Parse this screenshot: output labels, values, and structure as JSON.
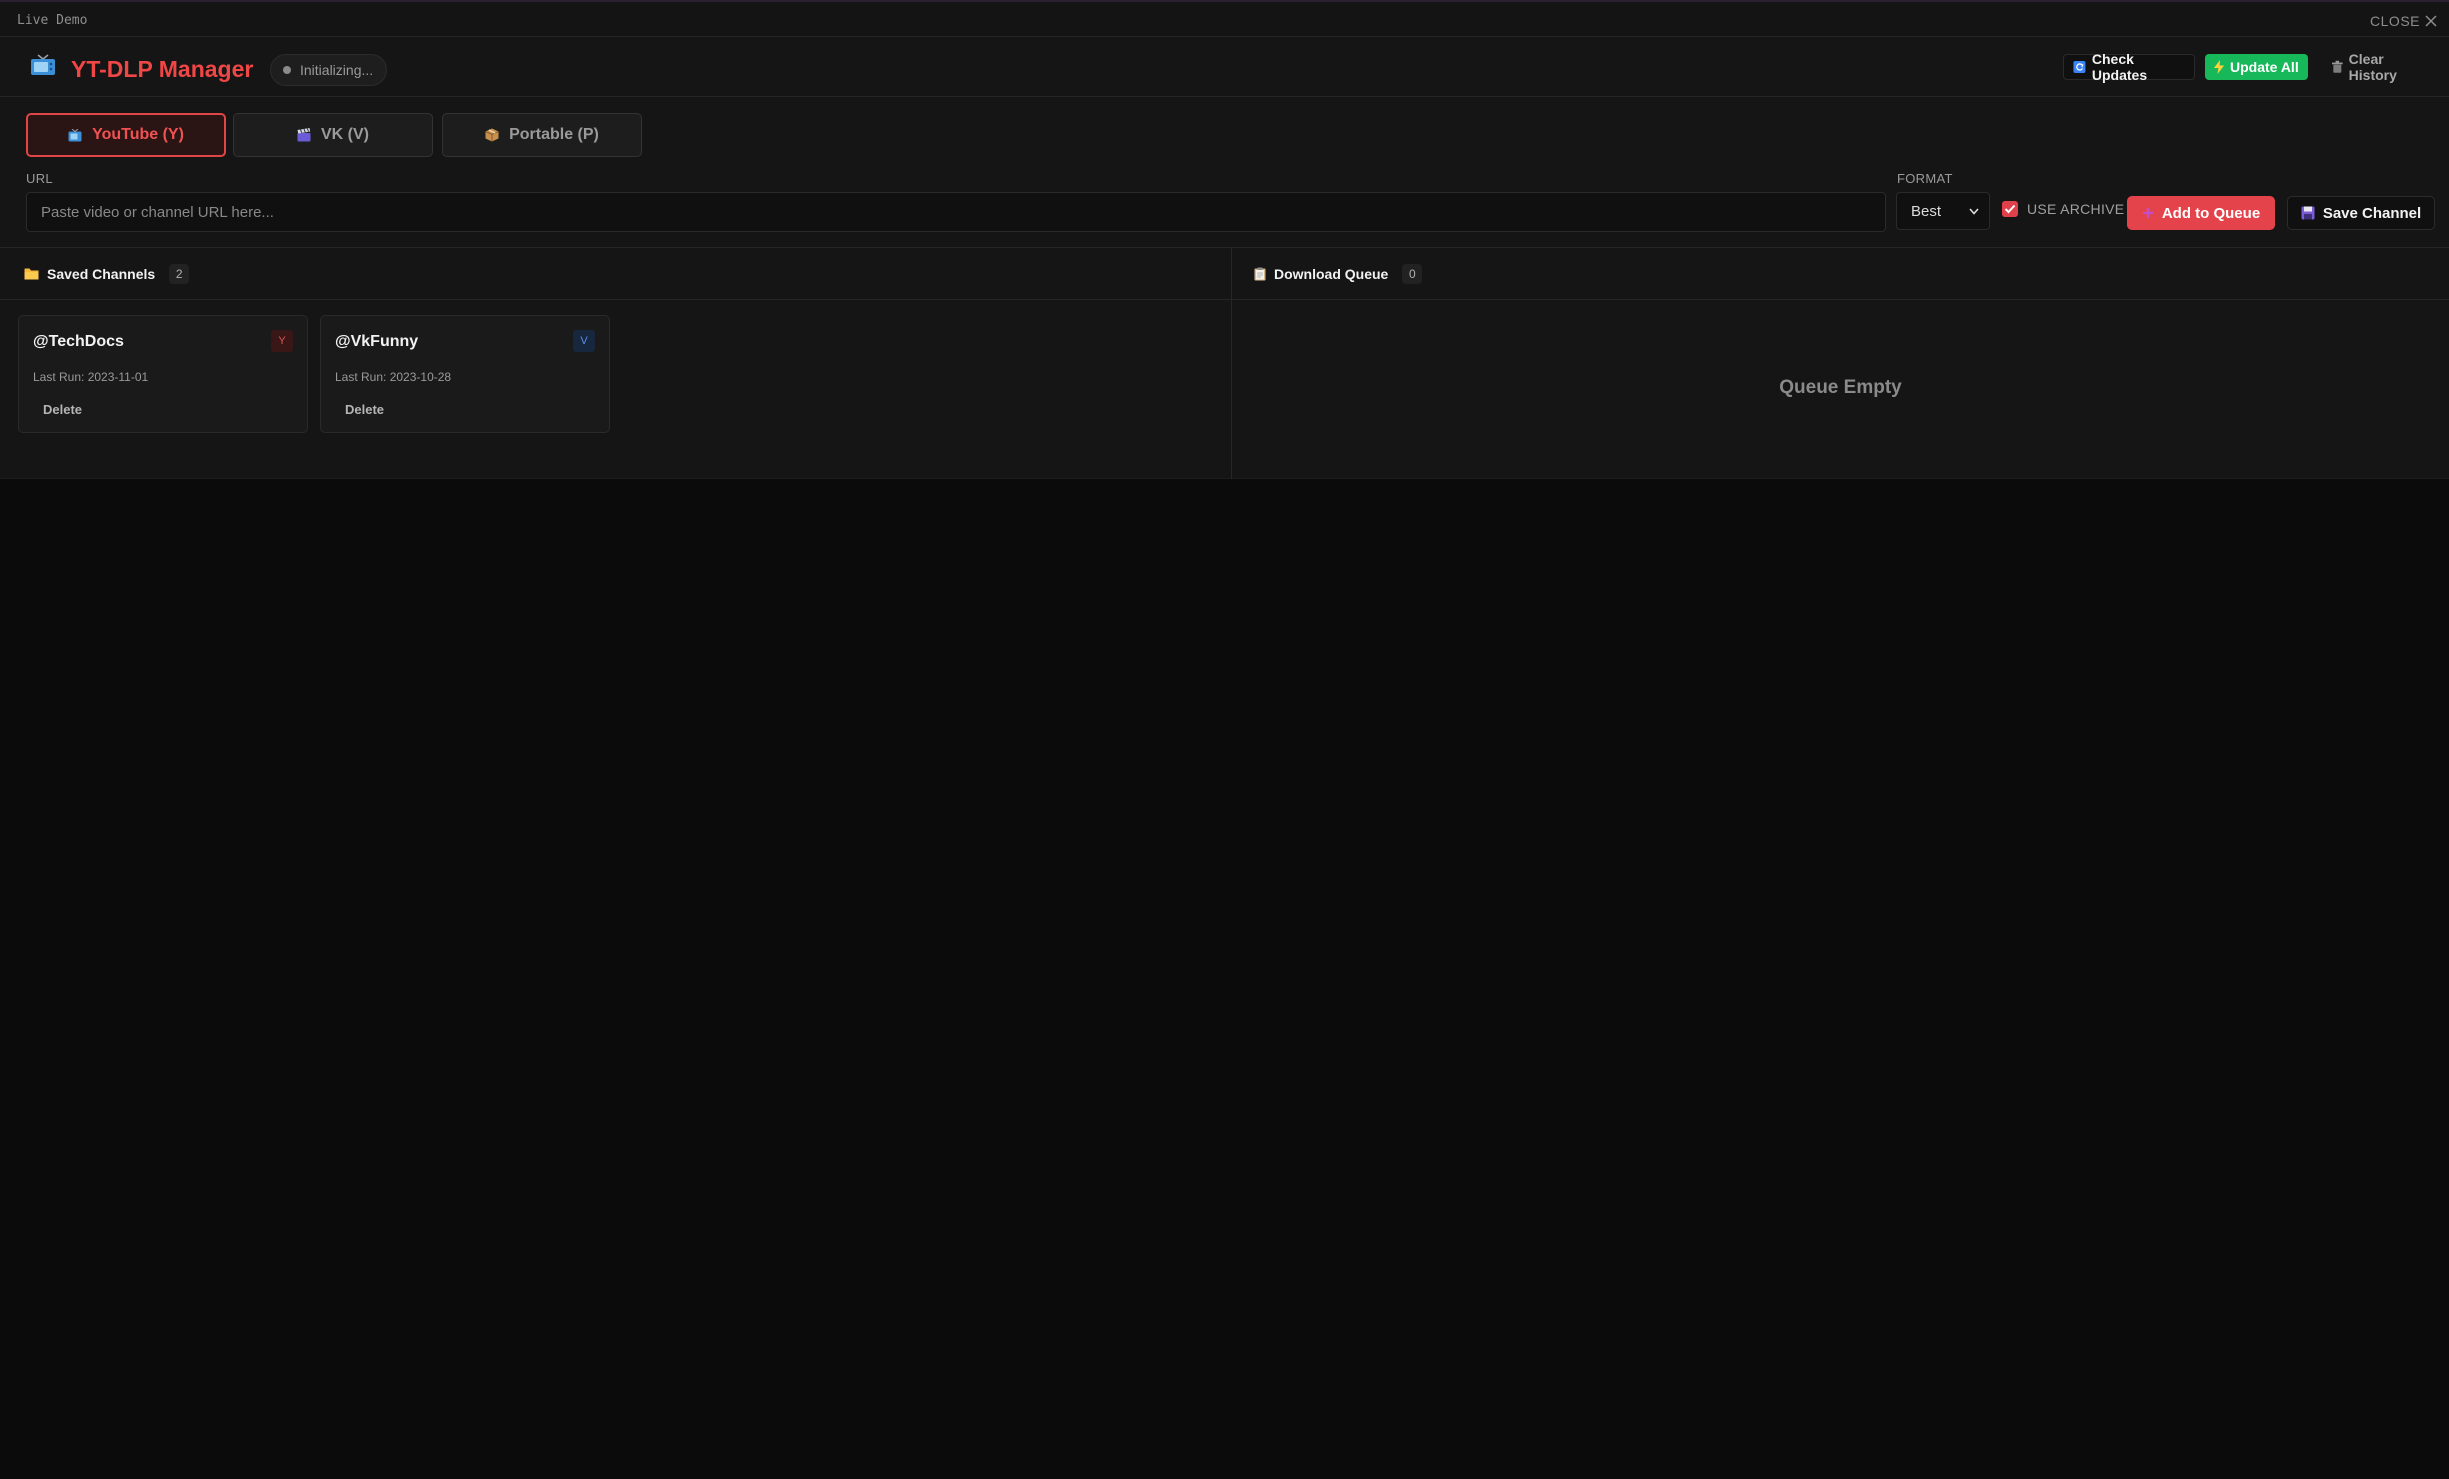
{
  "topbar": {
    "demo_label": "Live Demo",
    "close_label": "CLOSE"
  },
  "header": {
    "title": "YT-DLP Manager",
    "status": "Initializing...",
    "check_updates": "Check Updates",
    "update_all": "Update All",
    "clear_history": "Clear History"
  },
  "tabs": [
    {
      "label": "YouTube (Y)",
      "active": true
    },
    {
      "label": "VK (V)",
      "active": false
    },
    {
      "label": "Portable (P)",
      "active": false
    }
  ],
  "form": {
    "url_label": "URL",
    "url_placeholder": "Paste video or channel URL here...",
    "url_value": "",
    "format_label": "FORMAT",
    "format_value": "Best",
    "use_archive_label": "USE ARCHIVE",
    "use_archive_checked": true,
    "add_to_queue": "Add to Queue",
    "save_channel": "Save Channel"
  },
  "saved_channels": {
    "title": "Saved Channels",
    "count": "2",
    "items": [
      {
        "name": "@TechDocs",
        "badge": "Y",
        "last_run": "Last Run: 2023-11-01",
        "delete": "Delete"
      },
      {
        "name": "@VkFunny",
        "badge": "V",
        "last_run": "Last Run: 2023-10-28",
        "delete": "Delete"
      }
    ]
  },
  "queue": {
    "title": "Download Queue",
    "count": "0",
    "empty_text": "Queue Empty"
  },
  "colors": {
    "accent_red": "#ef4646",
    "update_green": "#17b85a",
    "background": "#0b0b0b",
    "panel": "#151515"
  },
  "icons": {
    "logo": "tv-icon",
    "check_updates": "refresh-icon",
    "update_all": "lightning-icon",
    "clear_history": "trash-icon",
    "youtube_tab": "tv-icon",
    "vk_tab": "clapperboard-icon",
    "portable_tab": "package-icon",
    "add_to_queue": "plus-icon",
    "save_channel": "floppy-disk-icon",
    "saved_channels": "folder-icon",
    "download_queue": "clipboard-icon"
  }
}
